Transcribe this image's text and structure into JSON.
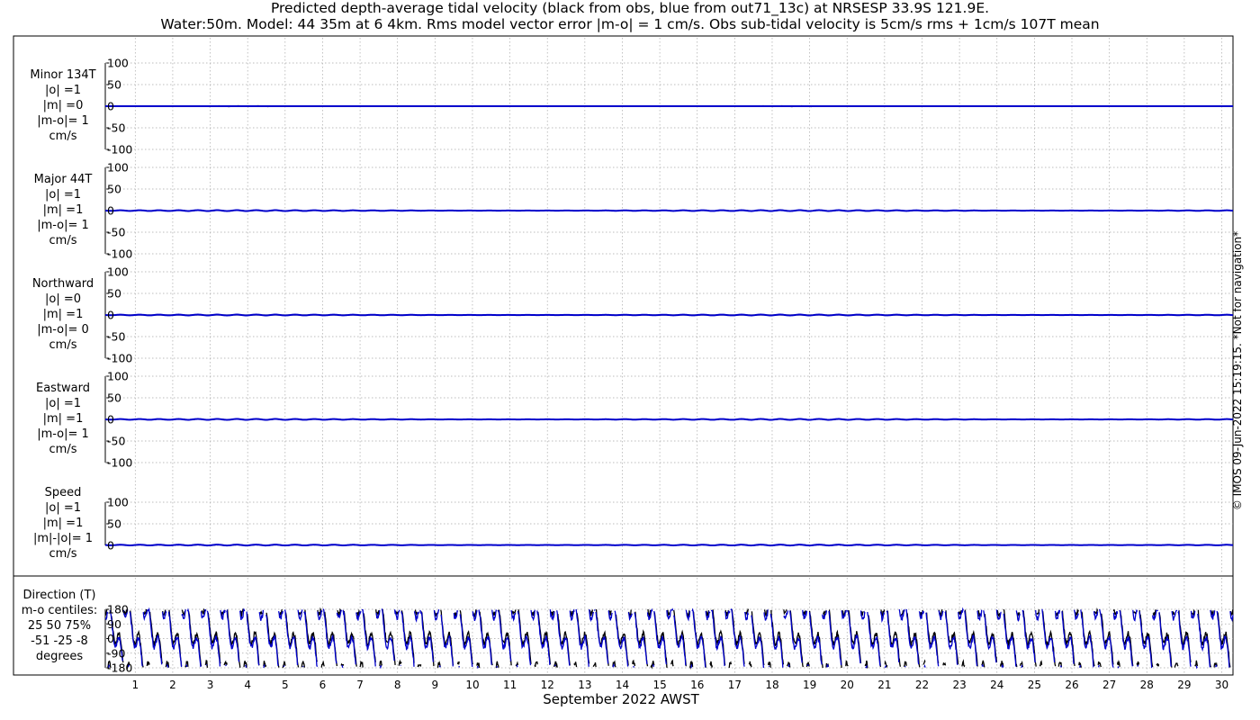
{
  "title": {
    "line1": "Predicted depth-average tidal velocity (black from obs, blue from out71_13c) at NRSESP 33.9S 121.9E.",
    "line2": "Water:50m. Model: 44 35m at 6 4km. Rms model vector error |m-o| = 1 cm/s. Obs sub-tidal velocity is 5cm/s rms + 1cm/s 107T mean"
  },
  "footnote": "© IMOS 09-Jun-2022 15:19:15. *Not for navigation*",
  "colors": {
    "obs": "#000000",
    "model": "#0000cc",
    "grid": "#a8a8a8"
  },
  "chart_data": {
    "type": "line",
    "xlabel": "September 2022 AWST",
    "x_ticks": [
      "1",
      "2",
      "3",
      "4",
      "5",
      "6",
      "7",
      "8",
      "9",
      "10",
      "11",
      "12",
      "13",
      "14",
      "15",
      "16",
      "17",
      "18",
      "19",
      "20",
      "21",
      "22",
      "23",
      "24",
      "25",
      "26",
      "27",
      "28",
      "29",
      "30"
    ],
    "xlim": [
      0.2,
      30.3
    ],
    "grid": true,
    "series_meaning": {
      "obs": "black from obs",
      "model": "blue from out71_13c"
    },
    "panels": [
      {
        "id": "minor",
        "label_lines": [
          "Minor 134T",
          "|o| =1",
          "|m| =0",
          "|m-o|= 1",
          "cm/s"
        ],
        "ylim": [
          -100,
          100
        ],
        "yticks": [
          "100",
          "50",
          "0",
          "-50",
          "-100"
        ],
        "obs_amplitude": 1,
        "model_amplitude": 0
      },
      {
        "id": "major",
        "label_lines": [
          "Major 44T",
          "|o| =1",
          "|m| =1",
          "|m-o|= 1",
          "cm/s"
        ],
        "ylim": [
          -100,
          100
        ],
        "yticks": [
          "100",
          "50",
          "0",
          "-50",
          "-100"
        ],
        "obs_amplitude": 1,
        "model_amplitude": 1
      },
      {
        "id": "north",
        "label_lines": [
          "Northward",
          "|o| =0",
          "|m| =1",
          "|m-o|= 0",
          "cm/s"
        ],
        "ylim": [
          -100,
          100
        ],
        "yticks": [
          "100",
          "50",
          "0",
          "-50",
          "-100"
        ],
        "obs_amplitude": 0,
        "model_amplitude": 1
      },
      {
        "id": "east",
        "label_lines": [
          "Eastward",
          "|o| =1",
          "|m| =1",
          "|m-o|= 1",
          "cm/s"
        ],
        "ylim": [
          -100,
          100
        ],
        "yticks": [
          "100",
          "50",
          "0",
          "-50",
          "-100"
        ],
        "obs_amplitude": 1,
        "model_amplitude": 1
      },
      {
        "id": "speed",
        "label_lines": [
          "Speed",
          "|o| =1",
          "|m| =1",
          "|m|-|o|= 1",
          "cm/s"
        ],
        "ylim": [
          0,
          100
        ],
        "yticks": [
          "100",
          "50",
          "0"
        ],
        "obs_amplitude": 1,
        "model_amplitude": 1
      },
      {
        "id": "direction",
        "label_lines": [
          "Direction (T)",
          "m-o centiles:",
          "25  50  75%",
          "-51 -25  -8",
          "degrees"
        ],
        "ylim": [
          -180,
          180
        ],
        "yticks": [
          "180",
          "90",
          "0",
          "-90",
          "-180"
        ],
        "obs_amplitude": 180,
        "model_amplitude": 180
      }
    ],
    "direction_centiles": {
      "percent": [
        25,
        50,
        75
      ],
      "degrees": [
        -51,
        -25,
        -8
      ]
    }
  }
}
